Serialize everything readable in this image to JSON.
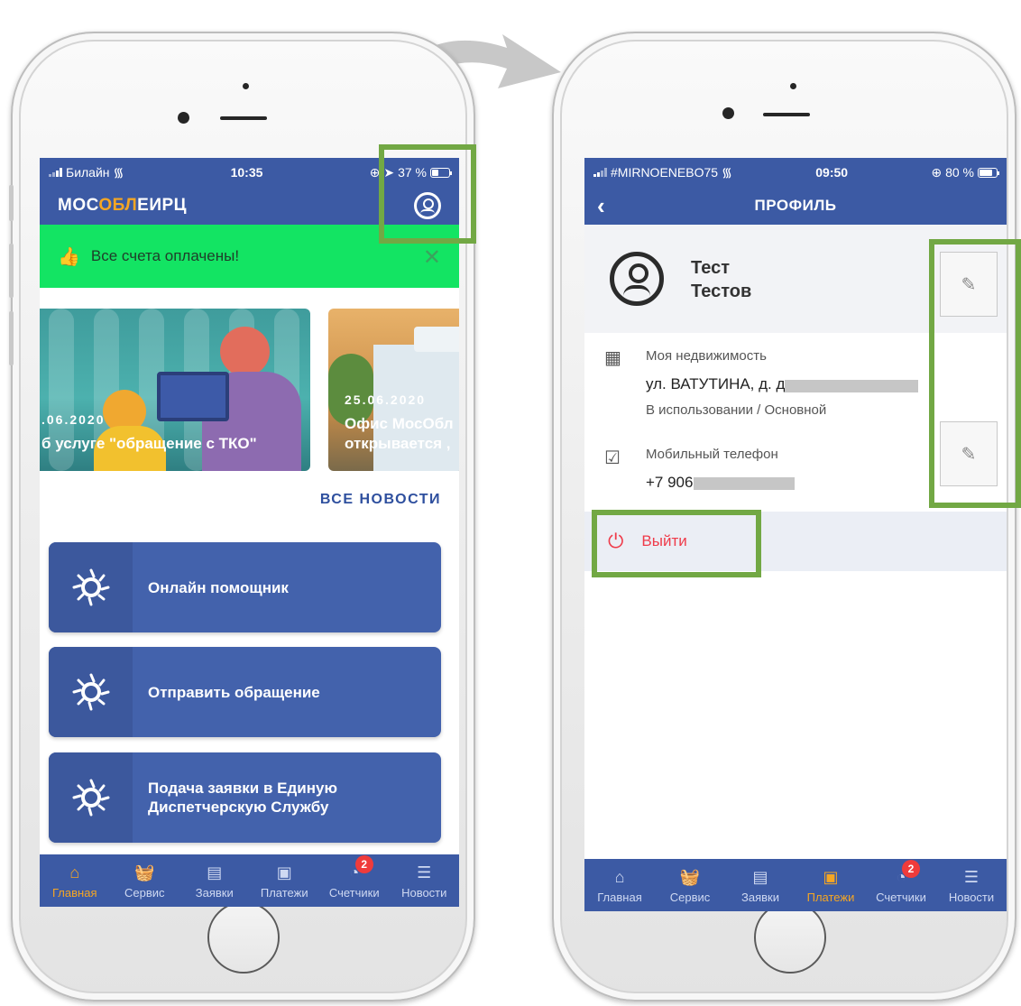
{
  "left": {
    "status": {
      "carrier": "Билайн",
      "time": "10:35",
      "battery": "37 %",
      "battery_level": 0.37
    },
    "header": {
      "logo_part1": "МОС",
      "logo_accent": "ОБЛ",
      "logo_part2": "ЕИРЦ"
    },
    "notice": {
      "text": "Все счета оплачены!"
    },
    "news": [
      {
        "date": ".06.2020",
        "title": "б услуге \"обращение с ТКО\""
      },
      {
        "date": "25.06.2020",
        "title": "Офис МосОбл",
        "title2": "открывается ,"
      }
    ],
    "all_news": "ВСЕ НОВОСТИ",
    "actions": [
      {
        "label": "Онлайн помощник"
      },
      {
        "label": "Отправить обращение"
      },
      {
        "label1": "Подача заявки в Единую",
        "label2": "Диспетчерскую Службу"
      }
    ],
    "tabs": [
      {
        "label": "Главная",
        "icon": "home-icon"
      },
      {
        "label": "Сервис",
        "icon": "basket-icon"
      },
      {
        "label": "Заявки",
        "icon": "requests-icon"
      },
      {
        "label": "Платежи",
        "icon": "wallet-icon"
      },
      {
        "label": "Счетчики",
        "icon": "meter-icon",
        "badge": "2"
      },
      {
        "label": "Новости",
        "icon": "news-icon"
      }
    ],
    "active_tab": "Главная"
  },
  "right": {
    "status": {
      "carrier": "#MIRNOENEBO75",
      "time": "09:50",
      "battery": "80 %",
      "battery_level": 0.8
    },
    "header": {
      "title": "ПРОФИЛЬ"
    },
    "profile": {
      "first_name": "Тест",
      "last_name": "Тестов"
    },
    "property": {
      "label": "Моя недвижимость",
      "address": "ул. ВАТУТИНА, д. д.",
      "status": "В использовании / Основной"
    },
    "phone": {
      "label": "Мобильный телефон",
      "value": "+7 906"
    },
    "logout": {
      "label": "Выйти"
    },
    "tabs": [
      {
        "label": "Главная",
        "icon": "home-icon"
      },
      {
        "label": "Сервис",
        "icon": "basket-icon"
      },
      {
        "label": "Заявки",
        "icon": "requests-icon"
      },
      {
        "label": "Платежи",
        "icon": "wallet-icon"
      },
      {
        "label": "Счетчики",
        "icon": "meter-icon",
        "badge": "2"
      },
      {
        "label": "Новости",
        "icon": "news-icon"
      }
    ],
    "active_tab": "Платежи"
  },
  "colors": {
    "brand_blue": "#3c5aa4",
    "accent_orange": "#f5a623",
    "success_green": "#13e463",
    "highlight_green": "#72a844",
    "logout_red": "#ef3b4a"
  }
}
